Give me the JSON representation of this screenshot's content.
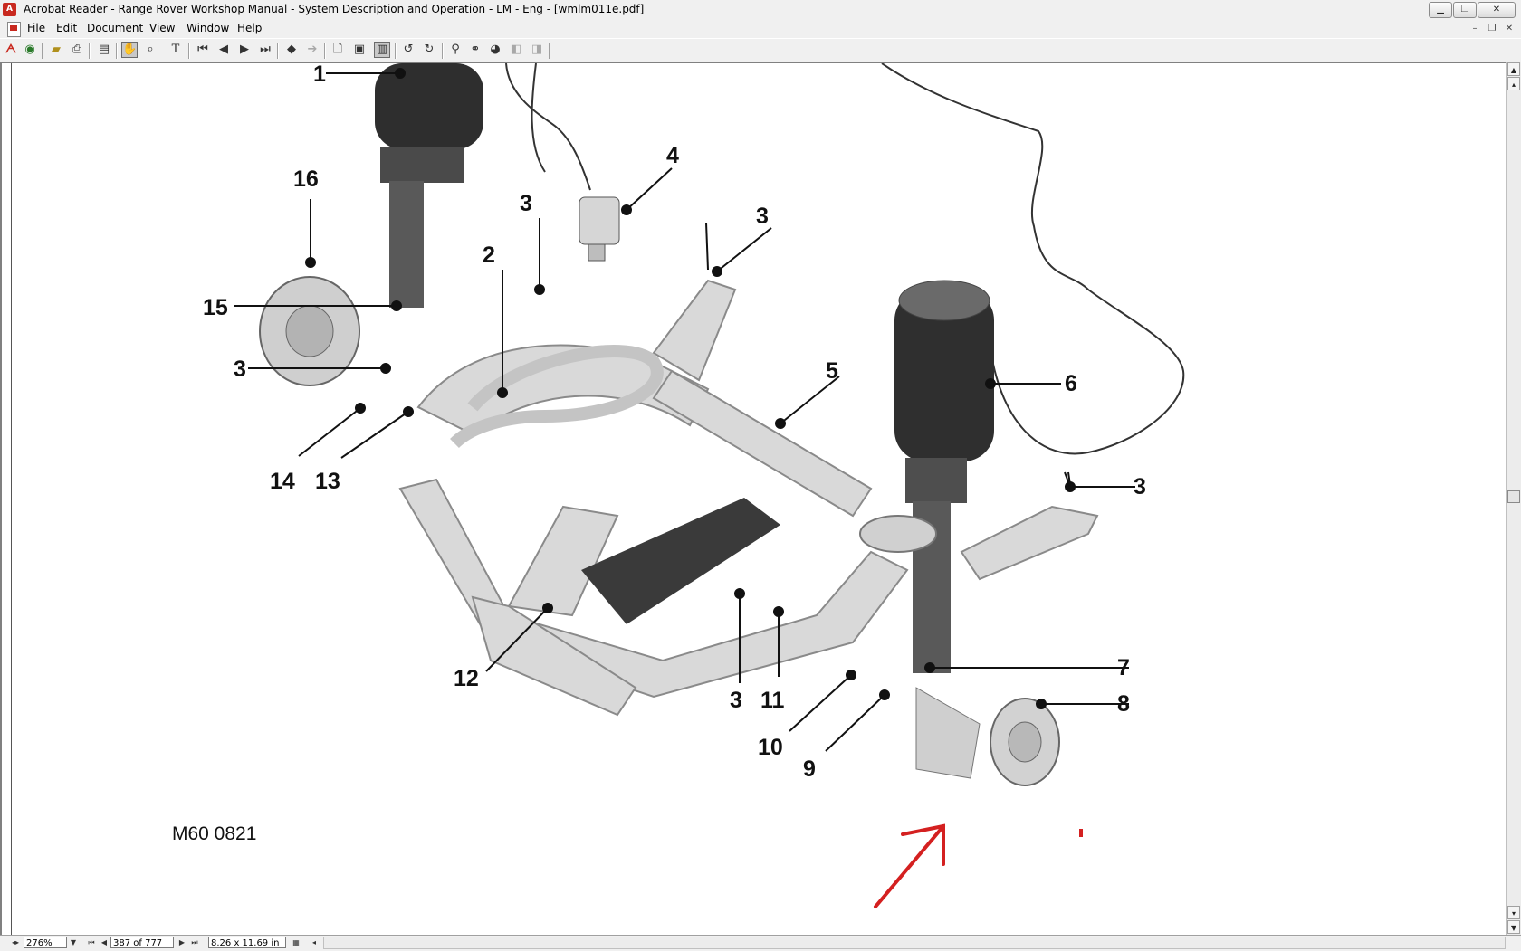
{
  "window": {
    "title": "Acrobat Reader - Range Rover Workshop Manual - System Description and Operation - LM - Eng - [wmlm011e.pdf]",
    "app_icon": "acrobat-icon"
  },
  "menubar": {
    "items": [
      "File",
      "Edit",
      "Document",
      "View",
      "Window",
      "Help"
    ]
  },
  "toolbar": {
    "icons": [
      "acrobat-logo-icon",
      "web-search-icon",
      "open-icon",
      "print-icon",
      "show-hide-navigation-icon",
      "hand-tool-icon",
      "zoom-tool-icon",
      "text-select-icon",
      "first-page-icon",
      "previous-page-icon",
      "next-page-icon",
      "last-page-icon",
      "go-back-icon",
      "go-forward-icon",
      "actual-size-icon",
      "fit-page-icon",
      "fit-width-icon",
      "rotate-left-icon",
      "rotate-right-icon",
      "find-icon",
      "search-icon",
      "search-results-icon",
      "previous-highlight-icon",
      "next-highlight-icon"
    ]
  },
  "document": {
    "figure_label": "M60 0821",
    "callouts": [
      "1",
      "2",
      "3",
      "4",
      "5",
      "6",
      "7",
      "8",
      "9",
      "10",
      "11",
      "12",
      "13",
      "14",
      "15",
      "16"
    ],
    "annotation": "red-arrow"
  },
  "statusbar": {
    "zoom": "276%",
    "page": "387 of 777",
    "page_size": "8.26 x 11.69 in"
  }
}
